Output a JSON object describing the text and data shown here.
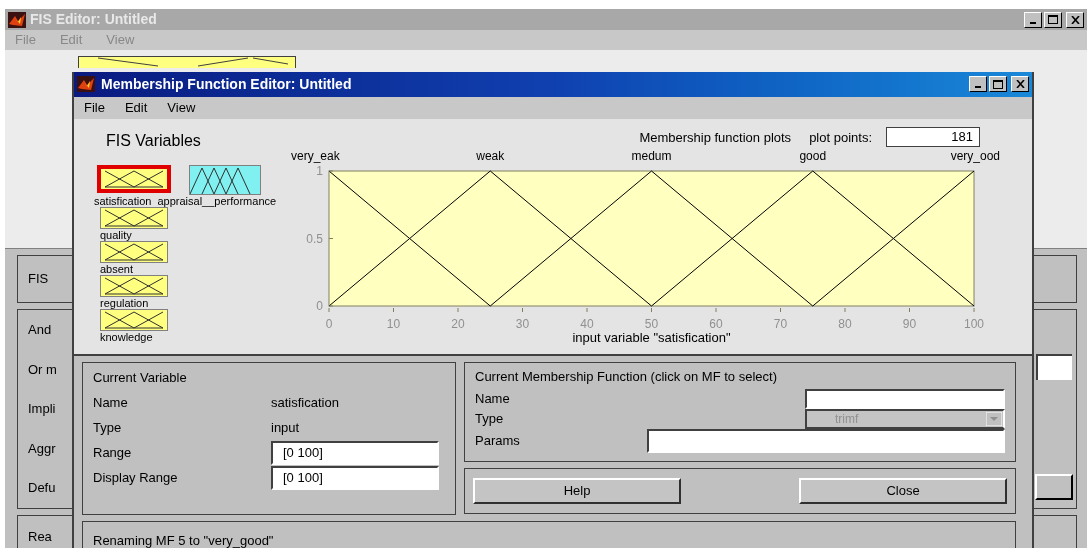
{
  "back_window": {
    "title": "FIS Editor: Untitled",
    "menu": [
      "File",
      "Edit",
      "View"
    ],
    "side_labels": [
      {
        "text": "FIS"
      },
      {
        "text": "And"
      },
      {
        "text": "Or m"
      },
      {
        "text": "Impli"
      },
      {
        "text": "Aggr"
      },
      {
        "text": "Defu"
      },
      {
        "text": "Rea"
      }
    ]
  },
  "window": {
    "title": "Membership Function Editor: Untitled",
    "menu": [
      "File",
      "Edit",
      "View"
    ]
  },
  "fis_variables": {
    "title": "FIS Variables",
    "items": [
      {
        "name": "satisfication",
        "kind": "input",
        "selected": true
      },
      {
        "name": "appraisal__performance",
        "kind": "output",
        "selected": false
      },
      {
        "name": "quality",
        "kind": "input",
        "selected": false
      },
      {
        "name": "absent",
        "kind": "input",
        "selected": false
      },
      {
        "name": "regulation",
        "kind": "input",
        "selected": false
      },
      {
        "name": "knowledge",
        "kind": "input",
        "selected": false
      }
    ]
  },
  "plot": {
    "title": "Membership function plots",
    "plot_points_label": "plot points:",
    "plot_points": "181",
    "chart_data": {
      "type": "line",
      "xlabel": "input variable \"satisfication\"",
      "x": [
        0,
        12.5,
        25,
        37.5,
        50,
        62.5,
        75,
        87.5,
        100
      ],
      "xlim": [
        0,
        100
      ],
      "ylim": [
        0,
        1
      ],
      "xticks": [
        0,
        10,
        20,
        30,
        40,
        50,
        60,
        70,
        80,
        90,
        100
      ],
      "yticks": [
        0,
        0.5,
        1
      ],
      "series": [
        {
          "name": "very_eak",
          "color": "#000000",
          "values": [
            1,
            0.5,
            0,
            null,
            null,
            null,
            null,
            null,
            null
          ]
        },
        {
          "name": "weak",
          "color": "#000000",
          "values": [
            0,
            0.5,
            1,
            0.5,
            0,
            null,
            null,
            null,
            null
          ]
        },
        {
          "name": "medum",
          "color": "#000000",
          "values": [
            null,
            null,
            0,
            0.5,
            1,
            0.5,
            0,
            null,
            null
          ]
        },
        {
          "name": "good",
          "color": "#000000",
          "values": [
            null,
            null,
            null,
            null,
            0,
            0.5,
            1,
            0.5,
            0
          ]
        },
        {
          "name": "very_ood",
          "color": "#000000",
          "values": [
            null,
            null,
            null,
            null,
            null,
            null,
            0,
            0.5,
            1
          ]
        }
      ]
    }
  },
  "current_variable": {
    "title": "Current Variable",
    "name_label": "Name",
    "name": "satisfication",
    "type_label": "Type",
    "type": "input",
    "range_label": "Range",
    "range": "[0 100]",
    "display_range_label": "Display Range",
    "display_range": "[0 100]"
  },
  "current_mf": {
    "title": "Current Membership Function (click on MF to select)",
    "name_label": "Name",
    "type_label": "Type",
    "type": "trimf",
    "type_disabled": true,
    "params_label": "Params"
  },
  "buttons": [
    "Help",
    "Close"
  ],
  "status": "Renaming MF 5 to \"very_good\""
}
